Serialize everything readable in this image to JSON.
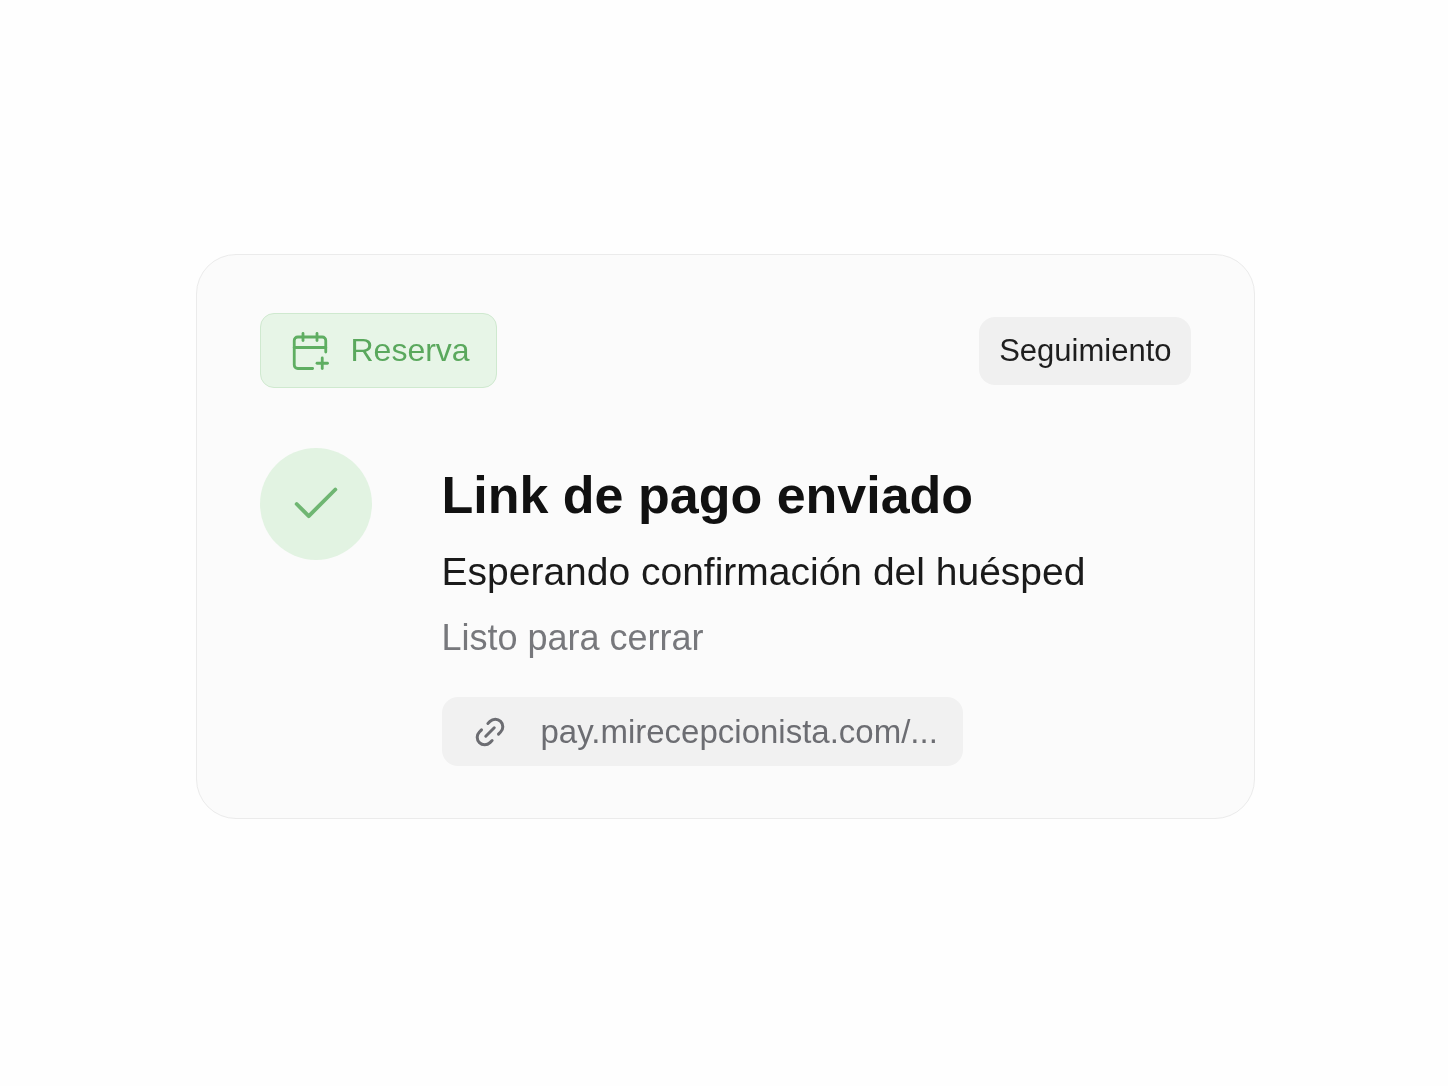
{
  "tag": {
    "label": "Reserva"
  },
  "status_pill": {
    "label": "Seguimiento"
  },
  "status": {
    "title": "Link de pago enviado",
    "subtitle": "Esperando confirmación del huésped",
    "note": "Listo para cerrar"
  },
  "payment_link": {
    "text": "pay.mirecepcionista.com/..."
  }
}
